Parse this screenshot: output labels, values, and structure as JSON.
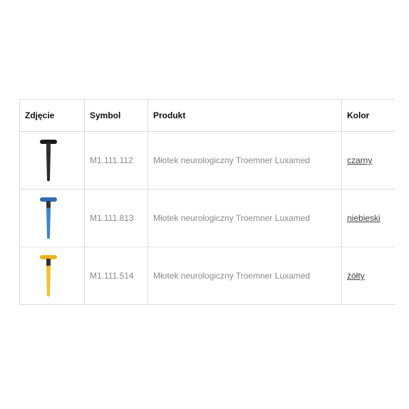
{
  "table": {
    "headers": [
      "Zdjęcie",
      "Symbol",
      "Produkt",
      "Kolor"
    ],
    "rows": [
      {
        "image_icon": "neurological-hammer-black-icon",
        "handle_color": "#2b2b2b",
        "head_color": "#1a1a1a",
        "symbol": "M1.111.112",
        "product": "Młotek neurologiczny Troemner Luxamed",
        "color": "czarny"
      },
      {
        "image_icon": "neurological-hammer-blue-icon",
        "handle_color": "#3d87c9",
        "head_color": "#2c6fb0",
        "symbol": "M1.111.813",
        "product": "Młotek neurologiczny Troemner Luxamed",
        "color": "niebieski"
      },
      {
        "image_icon": "neurological-hammer-yellow-icon",
        "handle_color": "#f2c12e",
        "head_color": "#e8b51f",
        "symbol": "M1.111.514",
        "product": "Młotek neurologiczny Troemner Luxamed",
        "color": "żółty"
      }
    ]
  }
}
